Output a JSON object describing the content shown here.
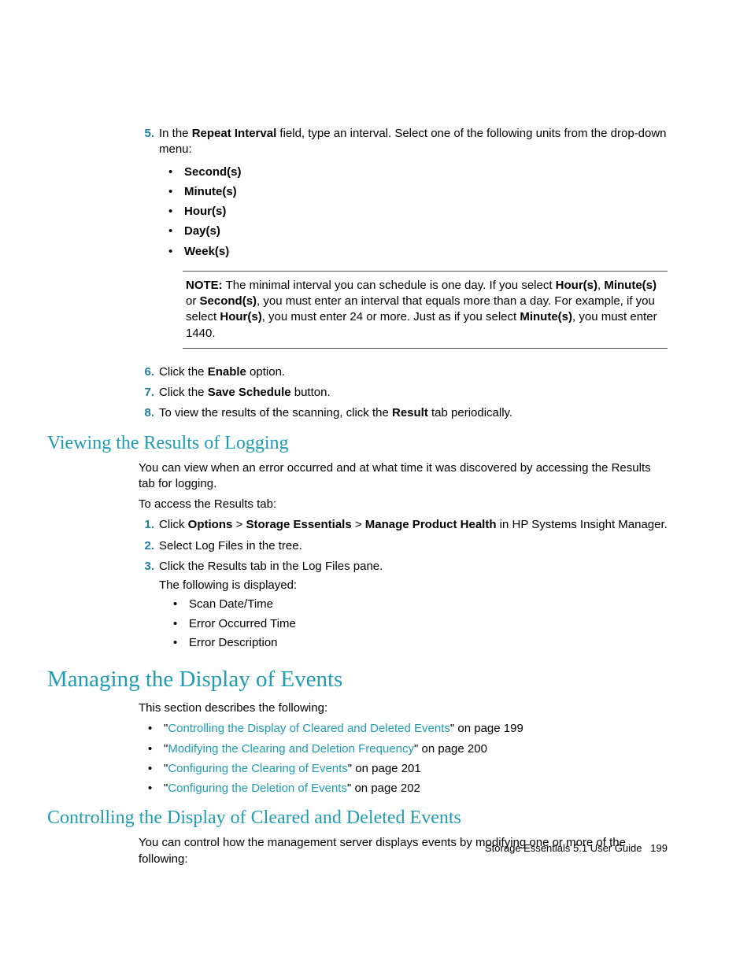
{
  "step5": {
    "num": "5.",
    "pre": "In the ",
    "b1": "Repeat Interval",
    "post": " field, type an interval. Select one of the following units from the drop-down menu:",
    "units": [
      "Second(s)",
      "Minute(s)",
      "Hour(s)",
      "Day(s)",
      "Week(s)"
    ]
  },
  "note": {
    "label": "NOTE:",
    "t1": "   The minimal interval you can schedule is one day. If you select ",
    "b1": "Hour(s)",
    "t2": ", ",
    "b2": "Minute(s)",
    "t3": " or ",
    "b3": "Second(s)",
    "t4": ", you must enter an interval that equals more than a day. For example, if you select ",
    "b4": "Hour(s)",
    "t5": ", you must enter 24 or more. Just as if you select ",
    "b5": "Minute(s)",
    "t6": ", you must enter 1440."
  },
  "step6": {
    "num": "6.",
    "pre": "Click the ",
    "b1": "Enable",
    "post": " option."
  },
  "step7": {
    "num": "7.",
    "pre": "Click the ",
    "b1": "Save Schedule",
    "post": " button."
  },
  "step8": {
    "num": "8.",
    "pre": "To view the results of the scanning, click the ",
    "b1": "Result",
    "post": " tab periodically."
  },
  "sec1": {
    "title": "Viewing the Results of Logging",
    "p1": "You can view when an error occurred and at what time it was discovered by accessing the Results tab for logging.",
    "p2": "To access the Results tab:",
    "s1": {
      "num": "1.",
      "pre": "Click ",
      "b1": "Options",
      "gt1": " > ",
      "b2": "Storage Essentials",
      "gt2": " > ",
      "b3": "Manage Product Health",
      "post": " in HP Systems Insight Manager."
    },
    "s2": {
      "num": "2.",
      "text": "Select Log Files in the tree."
    },
    "s3": {
      "num": "3.",
      "l1": "Click the Results tab in the Log Files pane.",
      "l2": "The following is displayed:",
      "items": [
        "Scan Date/Time",
        "Error Occurred Time",
        "Error Description"
      ]
    }
  },
  "sec2": {
    "title": "Managing the Display of Events",
    "p1": "This section describes the following:",
    "links": [
      {
        "text": "Controlling the Display of Cleared and Deleted Events",
        "page": "199"
      },
      {
        "text": "Modifying the Clearing and Deletion Frequency",
        "page": "200"
      },
      {
        "text": "Configuring the Clearing of Events",
        "page": "201"
      },
      {
        "text": "Configuring the Deletion of Events",
        "page": "202"
      }
    ]
  },
  "sec3": {
    "title": "Controlling the Display of Cleared and Deleted Events",
    "p1": "You can control how the management server displays events by modifying one or more of the following:"
  },
  "footer": {
    "title": "Storage Essentials 5.1 User Guide",
    "pagenum": "199"
  },
  "glyphs": {
    "bullet": "•",
    "quote_open": "\"",
    "quote_close": "\"",
    "onpage": " on page "
  }
}
